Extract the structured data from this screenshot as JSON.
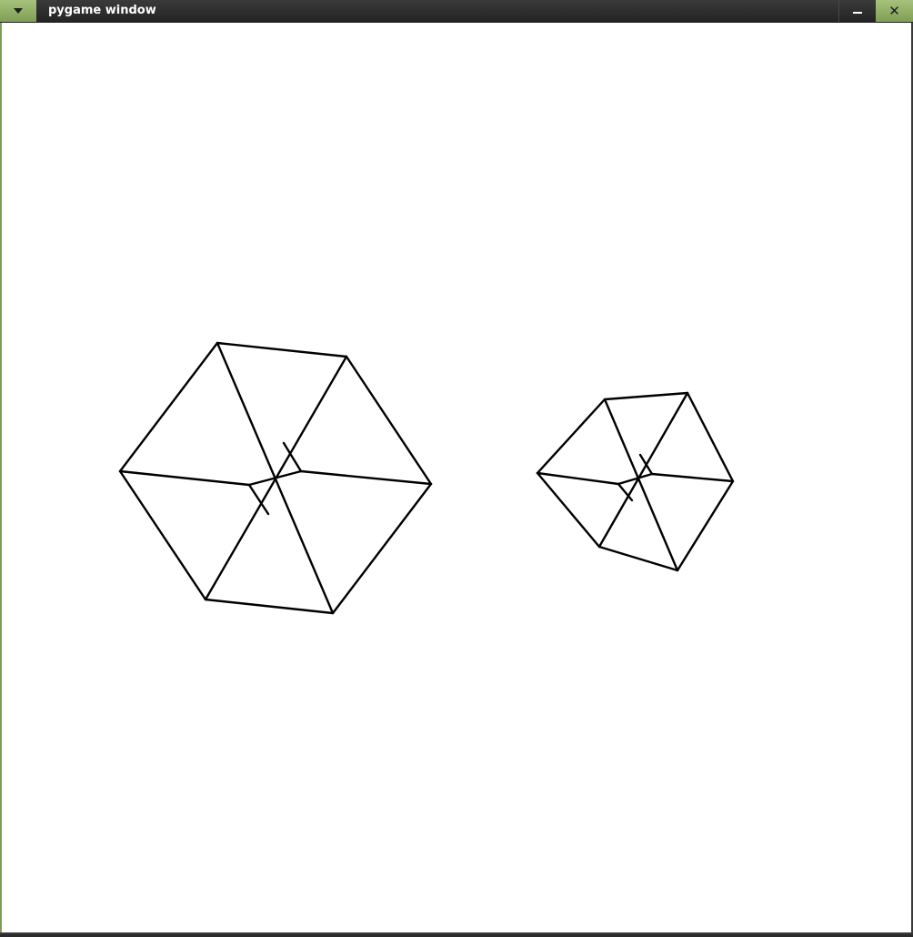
{
  "window": {
    "title": "pygame window",
    "controls": {
      "menu_icon": "chevron-down-icon",
      "minimize_icon": "minimize-icon",
      "close_icon": "close-icon",
      "close_glyph": "✕"
    },
    "accent_color": "#8fae64",
    "titlebar_color": "#2e2e2e"
  },
  "canvas": {
    "background": "#ffffff",
    "line_color": "#000000",
    "shapes": [
      "wireframe-cube",
      "wireframe-cube"
    ]
  }
}
